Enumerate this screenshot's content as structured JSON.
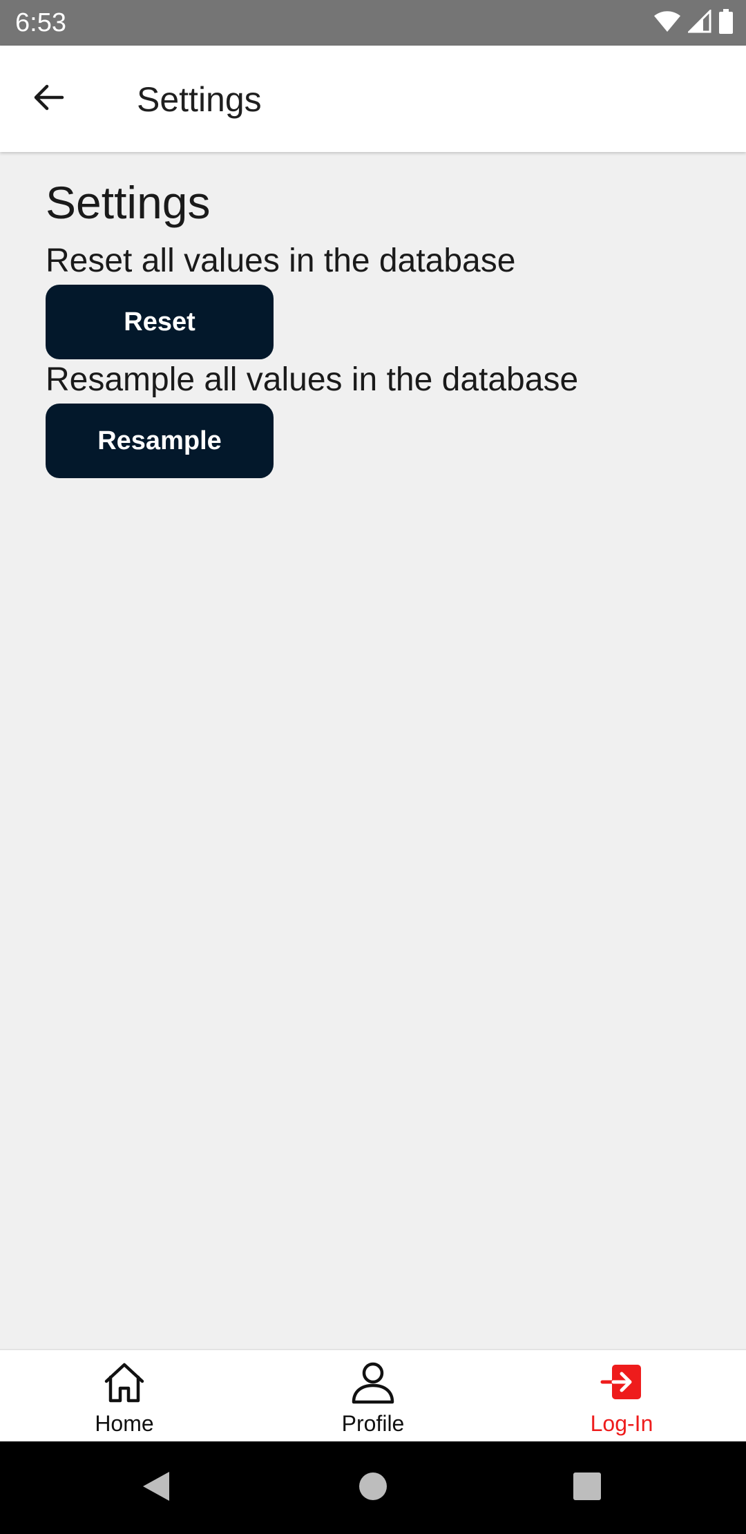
{
  "status_bar": {
    "time": "6:53",
    "icons": [
      "wifi-icon",
      "cellular-signal-icon",
      "battery-icon"
    ]
  },
  "app_bar": {
    "back_icon": "arrow-left-icon",
    "title": "Settings"
  },
  "main": {
    "heading": "Settings",
    "reset": {
      "description": "Reset all values in the database",
      "button_label": "Reset"
    },
    "resample": {
      "description": "Resample all values in the database",
      "button_label": "Resample"
    }
  },
  "bottom_nav": {
    "items": [
      {
        "label": "Home",
        "icon": "home-icon",
        "active": false
      },
      {
        "label": "Profile",
        "icon": "person-icon",
        "active": false
      },
      {
        "label": "Log-In",
        "icon": "login-icon",
        "active": true
      }
    ]
  },
  "system_nav": {
    "buttons": [
      "back-triangle-icon",
      "home-circle-icon",
      "recents-square-icon"
    ]
  },
  "colors": {
    "status_bar": "#757575",
    "app_bar": "#ffffff",
    "background": "#f0f0f0",
    "button": "#03182b",
    "active_nav": "#ee1c1c",
    "system_nav": "#000000"
  }
}
